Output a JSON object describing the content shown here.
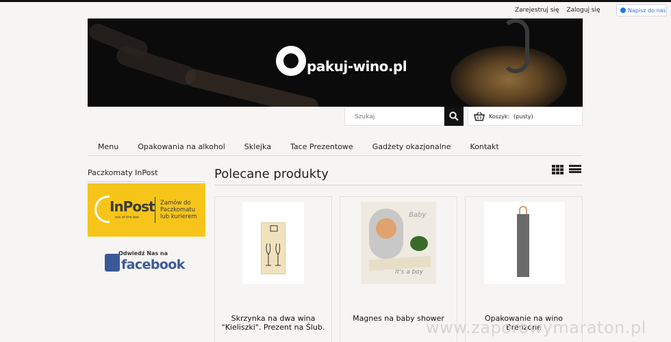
{
  "header": {
    "links": [
      "Zarejestruj się",
      "Zaloguj się"
    ],
    "message_button": "Napisz do nas"
  },
  "banner": {
    "logo_text": "pakuj-wino.pl"
  },
  "search": {
    "placeholder": "Szukaj"
  },
  "cart": {
    "label": "Koszyk:",
    "status": "(pusty)"
  },
  "nav": {
    "items": [
      "Menu",
      "Opakowania na alkohol",
      "Sklejka",
      "Tace Prezentowe",
      "Gadżety okazjonalne",
      "Kontakt"
    ]
  },
  "sidebar": {
    "title": "Paczkomaty InPost",
    "inpost": {
      "brand": "InPost",
      "tagline": "out of the box",
      "cta": [
        "Zamów do",
        "Paczkomatu",
        "lub kurierem"
      ]
    },
    "facebook": {
      "visit": "Odwiedź Nas na",
      "word": "facebook"
    }
  },
  "main": {
    "title": "Polecane produkty",
    "products": [
      {
        "name": "Skrzynka na dwa wina \"Kieliszki\". Prezent na Ślub."
      },
      {
        "name": "Magnes na baby shower",
        "image_text": "Baby",
        "image_sub": "It's a boy"
      },
      {
        "name": "Opakowanie na wino Brenzone"
      }
    ]
  },
  "watermark": "www.zaporowymaraton.pl"
}
